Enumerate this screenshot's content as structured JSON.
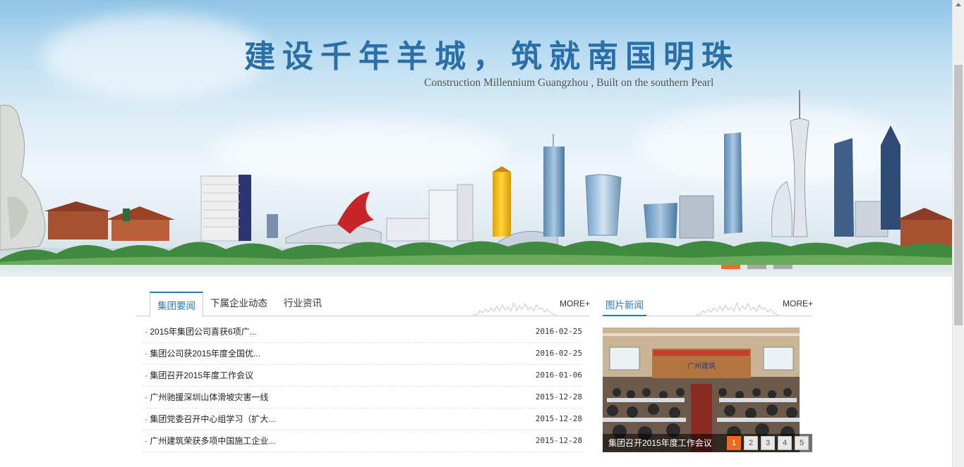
{
  "banner": {
    "slogan": "建设千年羊城，筑就南国明珠",
    "slogan_en": "Construction Millennium Guangzhou , Built on the southern Pearl",
    "slides": [
      {
        "label": "slide-1",
        "active": true
      },
      {
        "label": "slide-2",
        "active": false
      },
      {
        "label": "slide-3",
        "active": false
      }
    ]
  },
  "news": {
    "tabs": [
      {
        "label": "集团要闻",
        "active": true
      },
      {
        "label": "下属企业动态",
        "active": false
      },
      {
        "label": "行业资讯",
        "active": false
      }
    ],
    "more_label": "MORE+",
    "items": [
      {
        "title": "2015年集团公司喜获6项广...",
        "date": "2016-02-25"
      },
      {
        "title": "集团公司获2015年度全国优...",
        "date": "2016-02-25"
      },
      {
        "title": "集团召开2015年度工作会议",
        "date": "2016-01-06"
      },
      {
        "title": "广州驰援深圳山体滑坡灾害一线",
        "date": "2015-12-28"
      },
      {
        "title": "集团党委召开中心组学习（扩大...",
        "date": "2015-12-28"
      },
      {
        "title": "广州建筑荣获多项中国施工企业...",
        "date": "2015-12-28"
      }
    ]
  },
  "photo_news": {
    "title": "图片新闻",
    "more_label": "MORE+",
    "caption": "集团召开2015年度工作会议",
    "pages": [
      "1",
      "2",
      "3",
      "4",
      "5"
    ],
    "active_page": "1",
    "screen_text": "广州建筑"
  },
  "colors": {
    "accent": "#2e78b6",
    "active_dot": "#ed6b2f",
    "active_page": "#f16a18"
  }
}
